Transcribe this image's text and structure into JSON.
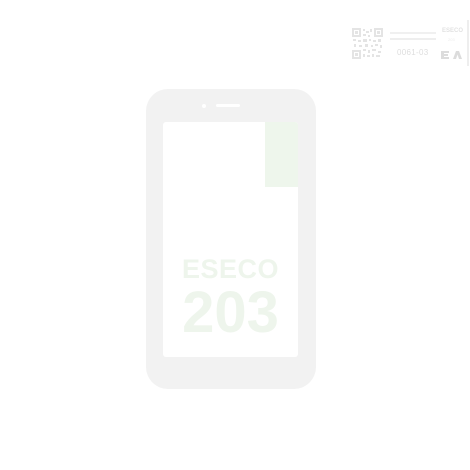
{
  "label": {
    "model_code": "0061-03",
    "brand_mini": "ESECO",
    "brand_sub": "203",
    "qr_icon": "qr-code-icon",
    "logo_icon": "brand-logo-icon"
  },
  "device": {
    "screen_brand": "ESECO",
    "screen_number": "203"
  },
  "colors": {
    "device_body": "#f2f2f2",
    "screen_text": "#eef5ec",
    "accent": "#eef6ec"
  }
}
